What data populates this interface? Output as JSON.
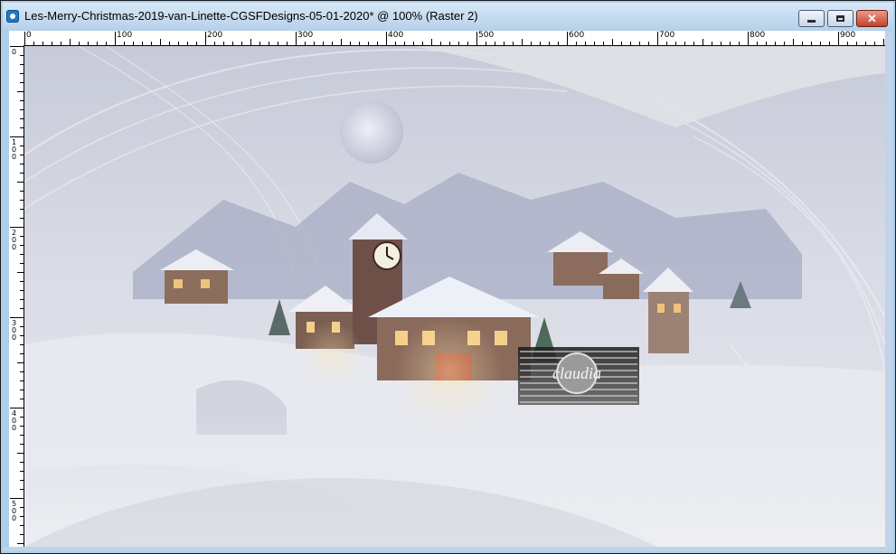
{
  "window": {
    "title": "Les-Merry-Christmas-2019-van-Linette-CGSFDesigns-05-01-2020* @ 100% (Raster 2)"
  },
  "buttons": {
    "minimize_icon": "minimize-icon",
    "maximize_icon": "maximize-icon",
    "close_icon": "close-icon",
    "close_glyph": "✕"
  },
  "ruler_top": {
    "labels": [
      "0",
      "100",
      "200",
      "300",
      "400",
      "500",
      "600",
      "700",
      "800",
      "900"
    ]
  },
  "ruler_left": {
    "labels": [
      "0",
      "100",
      "200",
      "300",
      "400",
      "500"
    ]
  },
  "canvas": {
    "watermark_text": "claudia",
    "colors": {
      "sky": "#c9ccd9",
      "snow": "#e9ebf1",
      "accent_warm": "#d9a46a",
      "shadow": "#7f86a3"
    }
  }
}
